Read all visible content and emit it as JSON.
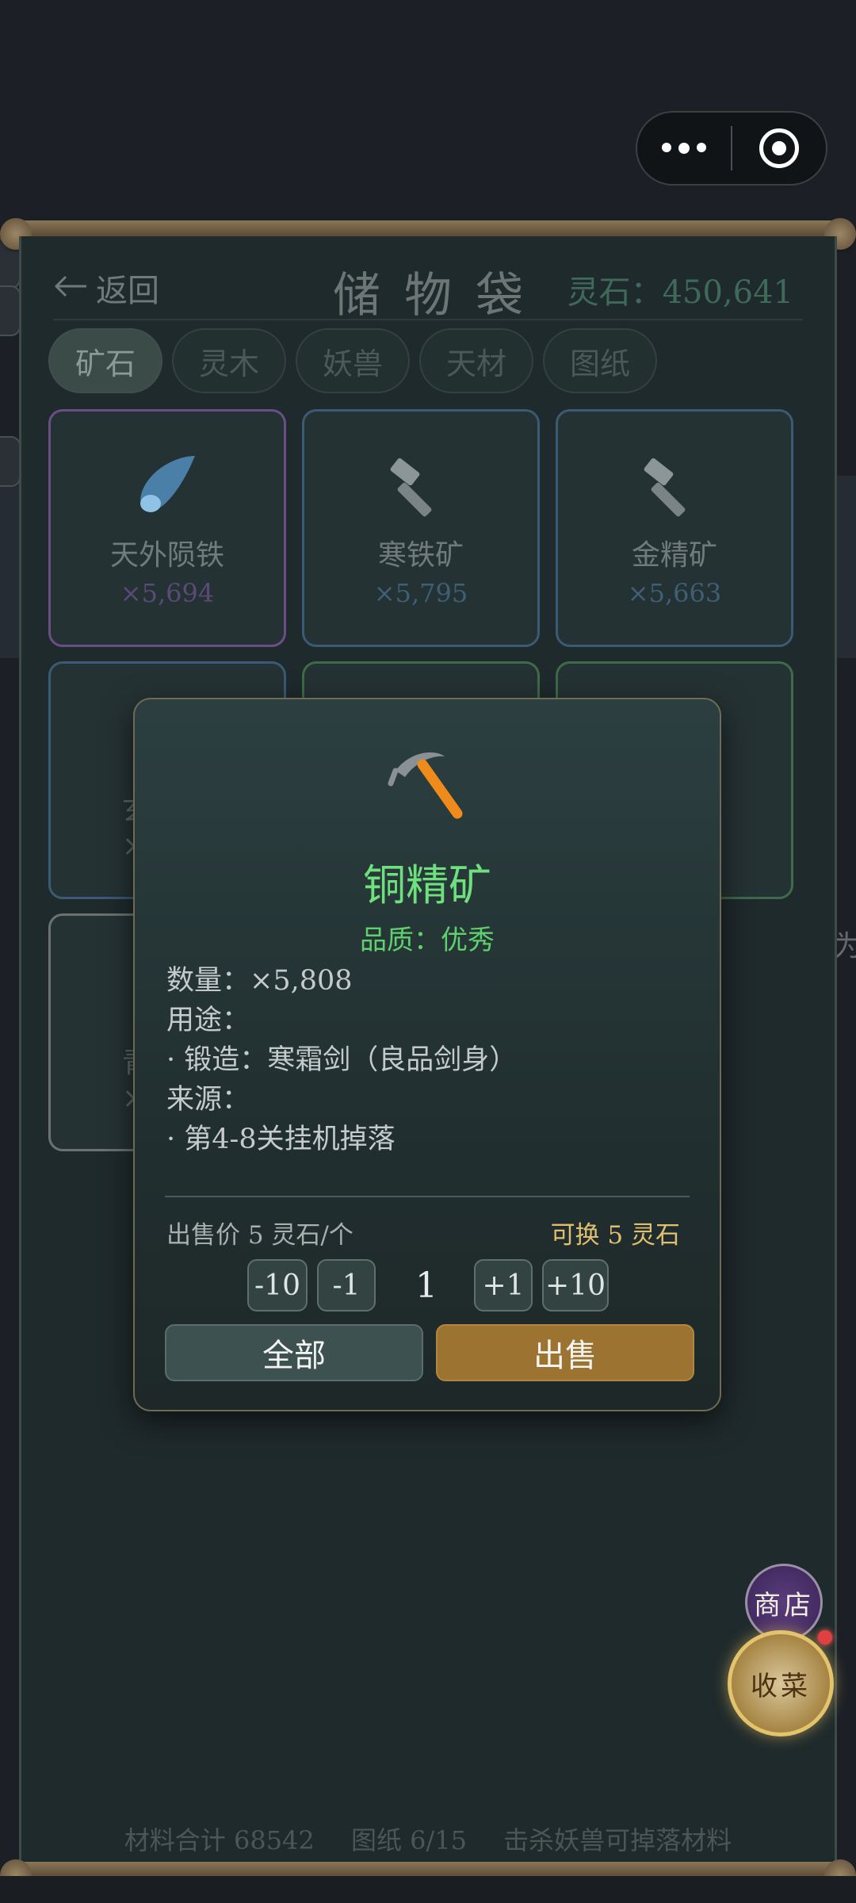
{
  "header": {
    "back_label": "返回",
    "title": "储物袋",
    "spirit_stones": "灵石：450,641"
  },
  "tabs": [
    {
      "label": "矿石",
      "active": true
    },
    {
      "label": "灵木",
      "active": false
    },
    {
      "label": "妖兽",
      "active": false
    },
    {
      "label": "天材",
      "active": false
    },
    {
      "label": "图纸",
      "active": false
    }
  ],
  "items": [
    {
      "name": "天外陨铁",
      "count": "×5,694",
      "icon": "meteor-icon",
      "rarity_color": "#6a4e86"
    },
    {
      "name": "寒铁矿",
      "count": "×5,795",
      "icon": "hammer-icon",
      "rarity_color": "#3b5a74"
    },
    {
      "name": "金精矿",
      "count": "×5,663",
      "icon": "hammer-icon",
      "rarity_color": "#3b5a74"
    },
    {
      "partial_name": "玄",
      "partial_count": "×"
    },
    {
      "partial_name": "青",
      "partial_count": "×"
    }
  ],
  "footer": {
    "materials": "材料合计 68542",
    "blueprints": "图纸 6/15",
    "hint": "击杀妖兽可掉落材料"
  },
  "floating": {
    "shop": "商店",
    "collect": "收菜"
  },
  "background_text": "为",
  "detail": {
    "icon": "pickaxe-icon",
    "name": "铜精矿",
    "quality": "品质：优秀",
    "quantity": "数量：×5,808",
    "usage_label": "用途：",
    "usage_item": "· 锻造：寒霜剑（良品剑身）",
    "source_label": "来源：",
    "source_item": "· 第4-8关挂机掉落",
    "sell_price": "出售价 5 灵石/个",
    "exchange": "可换 5 灵石",
    "stepper": {
      "minus10": "-10",
      "minus1": "-1",
      "quantity": "1",
      "plus1": "+1",
      "plus10": "+10"
    },
    "all_button": "全部",
    "sell_button": "出售"
  }
}
